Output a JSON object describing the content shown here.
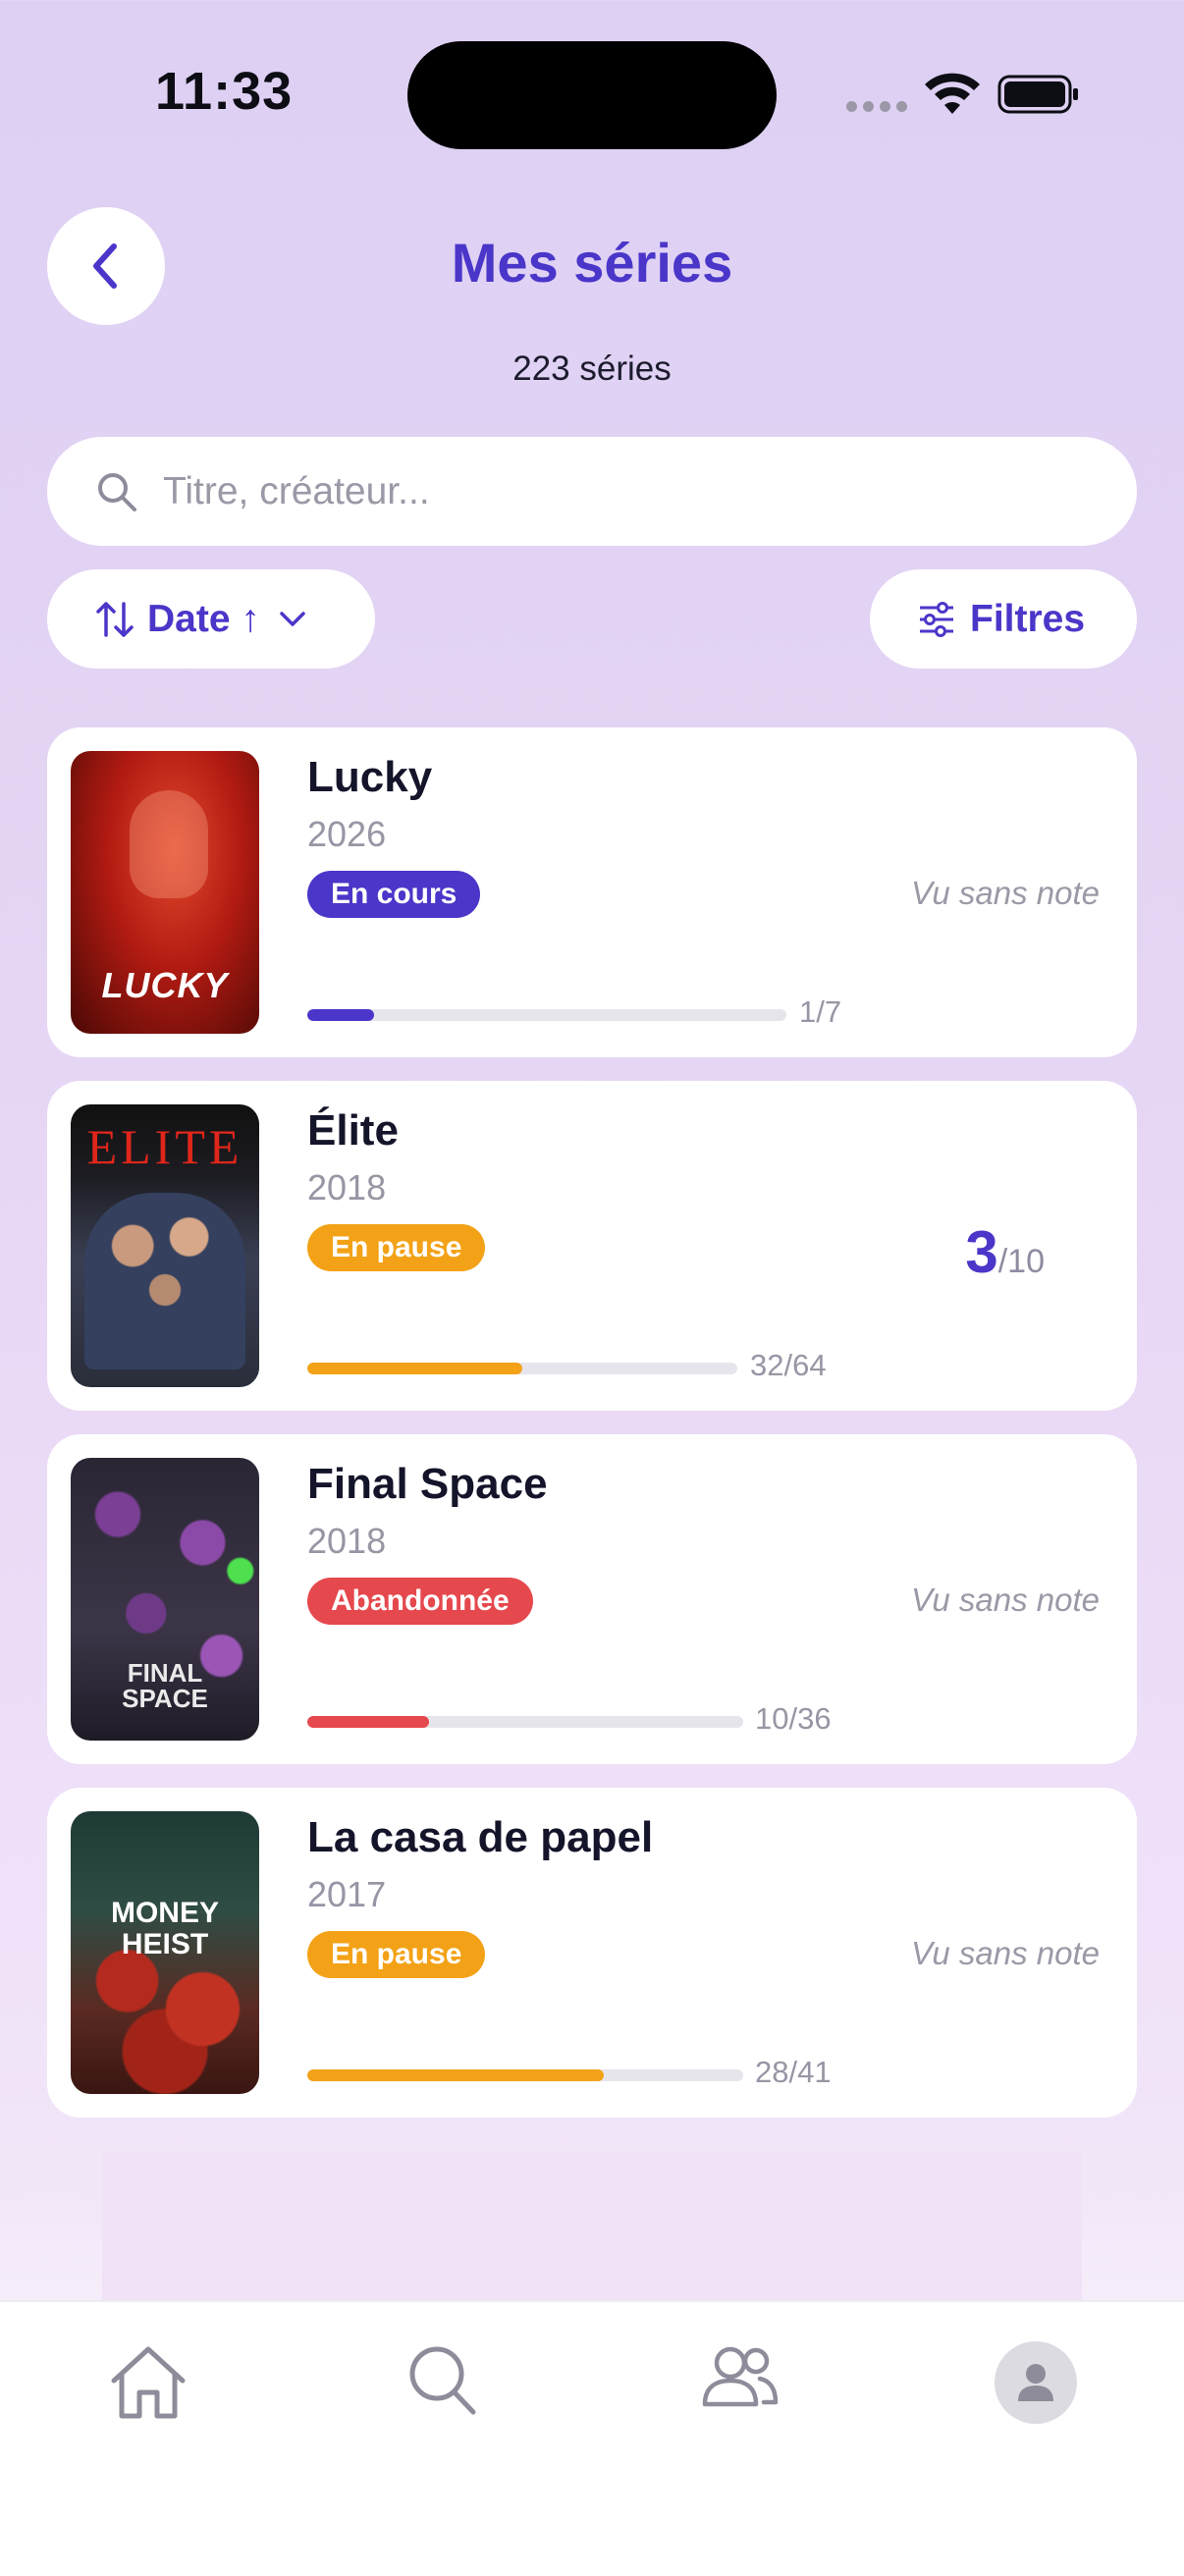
{
  "status_bar": {
    "time": "11:33"
  },
  "header": {
    "title": "Mes séries",
    "count": "223 séries"
  },
  "search": {
    "placeholder": "Titre, créateur..."
  },
  "sort": {
    "label": "Date ↑"
  },
  "filters": {
    "label": "Filtres"
  },
  "colors": {
    "accent": "#4a36c9",
    "in_progress": "#4a36c9",
    "paused": "#f3a217",
    "abandoned": "#e5484d"
  },
  "series": [
    {
      "title": "Lucky",
      "year": "2026",
      "status": "En cours",
      "rating_text": "Vu sans note",
      "progress_text": "1/7",
      "progress": 0.14,
      "poster_text": "LUCKY"
    },
    {
      "title": "Élite",
      "year": "2018",
      "status": "En pause",
      "rating_value": "3",
      "rating_max": "/10",
      "progress_text": "32/64",
      "progress": 0.5,
      "poster_text": "ELITE"
    },
    {
      "title": "Final Space",
      "year": "2018",
      "status": "Abandonnée",
      "rating_text": "Vu sans note",
      "progress_text": "10/36",
      "progress": 0.28,
      "poster_text": "FINAL SPACE"
    },
    {
      "title": "La casa de papel",
      "year": "2017",
      "status": "En pause",
      "rating_text": "Vu sans note",
      "progress_text": "28/41",
      "progress": 0.68,
      "poster_text": "MONEY HEIST"
    }
  ],
  "tabs": [
    {
      "icon": "home-icon"
    },
    {
      "icon": "search-icon"
    },
    {
      "icon": "friends-icon"
    },
    {
      "icon": "profile-avatar-icon"
    }
  ]
}
